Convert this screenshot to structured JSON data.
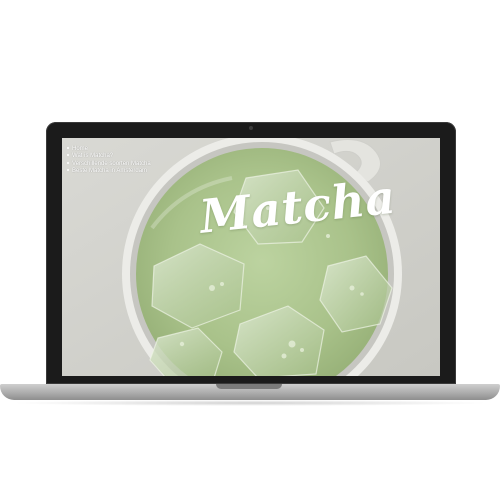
{
  "site": {
    "title": "Matcha",
    "nav": [
      {
        "label": "Home"
      },
      {
        "label": "Wat is Matcha?"
      },
      {
        "label": "Verschillende soorten Matcha"
      },
      {
        "label": "Beste Matcha in Amsterdam"
      }
    ]
  },
  "colors": {
    "bezel": "#1b1b1b",
    "laptop_base": "#a9a9a9",
    "matcha_green": "#a9c28a",
    "ice": "#c7d8b6",
    "nav_text": "#ffffff"
  }
}
